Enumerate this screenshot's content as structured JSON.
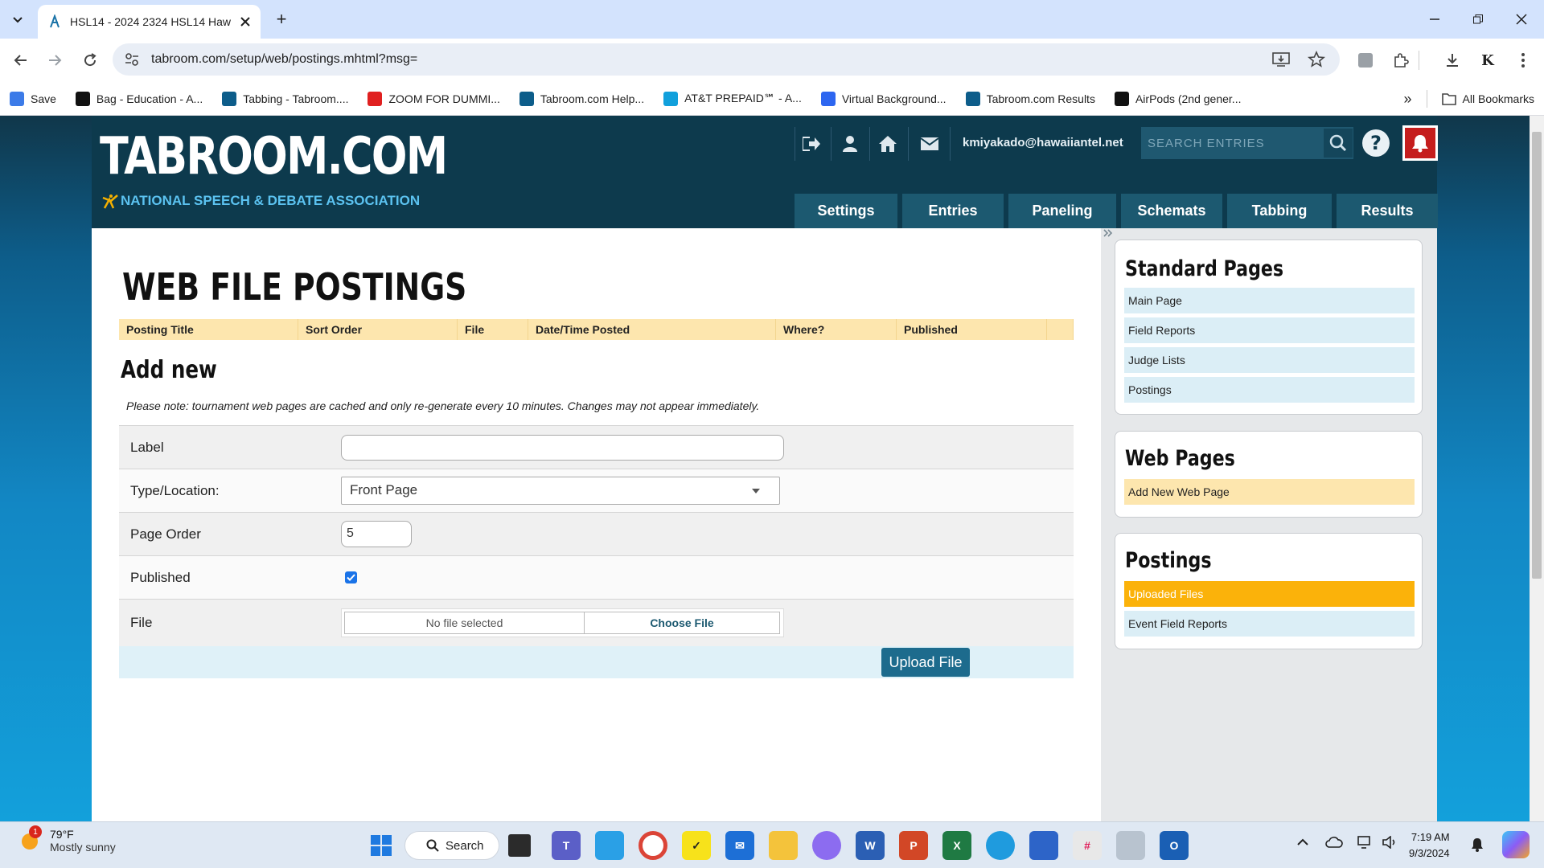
{
  "browser": {
    "tab_title": "HSL14 - 2024 2324 HSL14 Haw",
    "url": "tabroom.com/setup/web/postings.mhtml?msg=",
    "bookmarks": [
      {
        "label": "Save",
        "color": "#3c7be8"
      },
      {
        "label": "Bag - Education - A...",
        "color": "#111111"
      },
      {
        "label": "Tabbing - Tabroom....",
        "color": "#0d5d8a"
      },
      {
        "label": "ZOOM FOR DUMMI...",
        "color": "#e02020"
      },
      {
        "label": "Tabroom.com Help...",
        "color": "#0d5d8a"
      },
      {
        "label": "AT&T PREPAID℠ - A...",
        "color": "#11a0dc"
      },
      {
        "label": "Virtual Background...",
        "color": "#2d66f0"
      },
      {
        "label": "Tabroom.com Results",
        "color": "#0d5d8a"
      },
      {
        "label": "AirPods (2nd gener...",
        "color": "#111111"
      }
    ],
    "all_bookmarks": "All Bookmarks",
    "overflow": "»"
  },
  "header": {
    "logo": "TABROOM.COM",
    "logo_sub": "NATIONAL SPEECH & DEBATE ASSOCIATION",
    "user_email": "kmiyakado@hawaiiantel.net",
    "search_placeholder": "SEARCH ENTRIES",
    "help": "?",
    "menu": [
      "Settings",
      "Entries",
      "Paneling",
      "Schemats",
      "Tabbing",
      "Results"
    ]
  },
  "main": {
    "title": "WEB FILE POSTINGS",
    "table_headers": [
      "Posting Title",
      "Sort Order",
      "File",
      "Date/Time Posted",
      "Where?",
      "Published",
      ""
    ],
    "add_new": "Add new",
    "note": "Please note: tournament web pages are cached and only re-generate every 10 minutes. Changes may not appear immediately.",
    "form": {
      "label_label": "Label",
      "label_value": "",
      "type_label": "Type/Location:",
      "type_value": "Front Page",
      "order_label": "Page Order",
      "order_value": "5",
      "published_label": "Published",
      "published_checked": true,
      "file_label": "File",
      "no_file": "No file selected",
      "choose_file": "Choose File",
      "upload": "Upload File"
    }
  },
  "sidebar": {
    "standard_title": "Standard Pages",
    "standard_items": [
      "Main Page",
      "Field Reports",
      "Judge Lists",
      "Postings"
    ],
    "web_title": "Web Pages",
    "web_items": [
      "Add New Web Page"
    ],
    "postings_title": "Postings",
    "postings_items": [
      "Uploaded Files",
      "Event Field Reports"
    ],
    "active_color": "#fbb20a",
    "highlight_color": "#fde6ae"
  },
  "taskbar": {
    "weather_badge": "1",
    "temp": "79°F",
    "condition": "Mostly sunny",
    "search": "Search",
    "time": "7:19 AM",
    "date": "9/3/2024"
  }
}
